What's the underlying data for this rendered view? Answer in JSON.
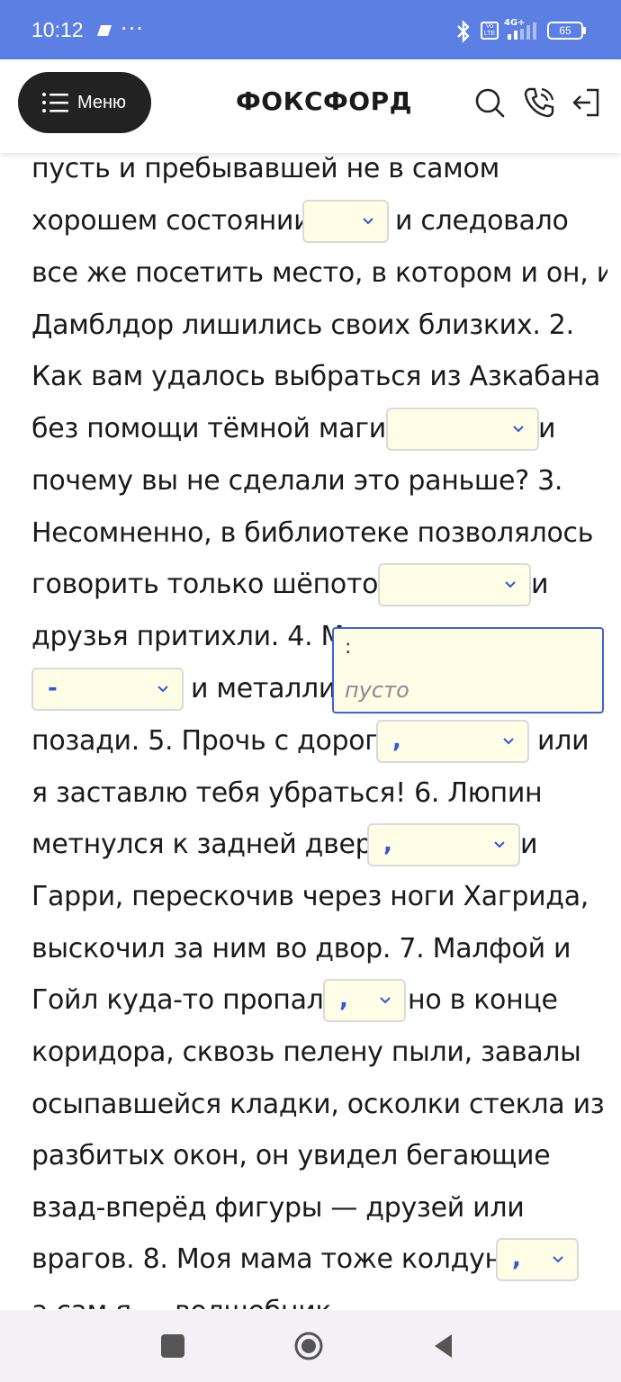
{
  "status_bar": {
    "time": "10:12",
    "ellipsis": "···",
    "battery": "65",
    "network": "4G+",
    "volte": "Vo LTE"
  },
  "header": {
    "menu_label": "Меню",
    "logo": "ФОКСФОРД"
  },
  "lines": [
    "пусть и пребывавшей не в самом",
    "хорошем состоянии",
    "и следовало",
    "все же посетить место, в котором и он, и",
    "Дамблдор лишились своих близких. 2.",
    "Как вам удалось выбраться из Азкабана",
    "без помощи тёмной магии",
    "и",
    "почему вы не сделали это раньше? 3.",
    "Несомненно, в библиотеке позволялось",
    "говорить только шёпотом",
    "и",
    "друзья притихли. 4. Мг",
    "и металлич",
    "позади. 5. Прочь с дороги",
    "или",
    "я заставлю тебя убраться! 6. Люпин",
    "метнулся к задней двери",
    "и",
    "Гарри, перескочив через ноги Хагрида,",
    "выскочил за ним во двор. 7. Малфой и",
    "Гойл куда-то пропали",
    "но в конце",
    "коридора, сквозь пелену пыли, завалы",
    "осыпавшейся кладки, осколки стекла из",
    "разбитых окон, он увидел бегающие",
    "взад-вперёд фигуры — друзей или",
    "врагов. 8. Моя мама тоже колдунья",
    "а сам я — волшебник"
  ],
  "dropdowns": {
    "d1": "",
    "d2": "",
    "d3": "",
    "d4": "-",
    "d5": ",",
    "d6": ",",
    "d7": ",",
    "d8": ","
  },
  "popup": {
    "option_colon": ":",
    "option_empty": "пусто"
  },
  "colors": {
    "status_bar": "#5B7FE3",
    "dropdown_bg": "#FFFDE6",
    "selected_value": "#2f59d6",
    "popup_border": "#3e63d6"
  }
}
